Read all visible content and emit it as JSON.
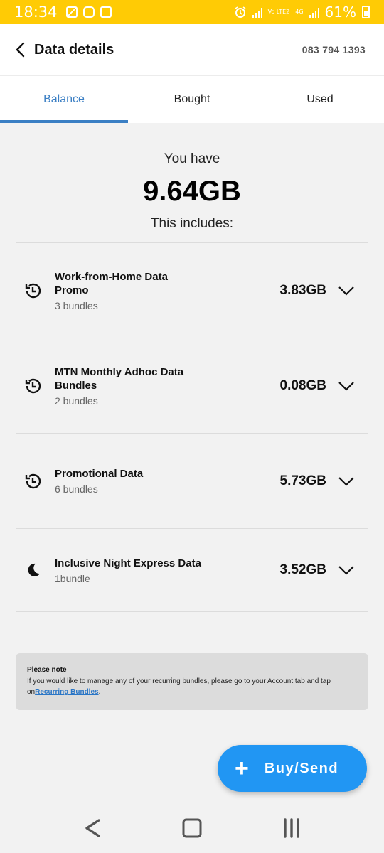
{
  "status_bar": {
    "time": "18:34",
    "battery": "61%",
    "network": "4G",
    "volte": "Vo LTE2"
  },
  "header": {
    "title": "Data details",
    "phone": "083 794 1393"
  },
  "tabs": [
    {
      "label": "Balance",
      "active": true
    },
    {
      "label": "Bought",
      "active": false
    },
    {
      "label": "Used",
      "active": false
    }
  ],
  "summary": {
    "you_have": "You have",
    "total": "9.64GB",
    "includes": "This includes:"
  },
  "bundles": [
    {
      "name": "Work-from-Home Data Promo",
      "count": "3 bundles",
      "amount": "3.83GB",
      "icon": "clock-refresh-icon"
    },
    {
      "name": "MTN Monthly Adhoc Data Bundles",
      "count": "2 bundles",
      "amount": "0.08GB",
      "icon": "clock-refresh-icon"
    },
    {
      "name": "Promotional Data",
      "count": "6 bundles",
      "amount": "5.73GB",
      "icon": "clock-refresh-icon"
    },
    {
      "name": "Inclusive Night Express Data",
      "count": "1bundle",
      "amount": "3.52GB",
      "icon": "moon-icon"
    }
  ],
  "note": {
    "title": "Please note",
    "body": "If you would like to manage any of your recurring bundles, please go to your Account tab and tap on",
    "link": "Recurring Bundles",
    "suffix": "."
  },
  "fab": {
    "label": "Buy/Send"
  },
  "colors": {
    "brand_yellow": "#ffcb05",
    "accent_blue": "#3b7fc4",
    "fab_blue": "#2196f3"
  }
}
